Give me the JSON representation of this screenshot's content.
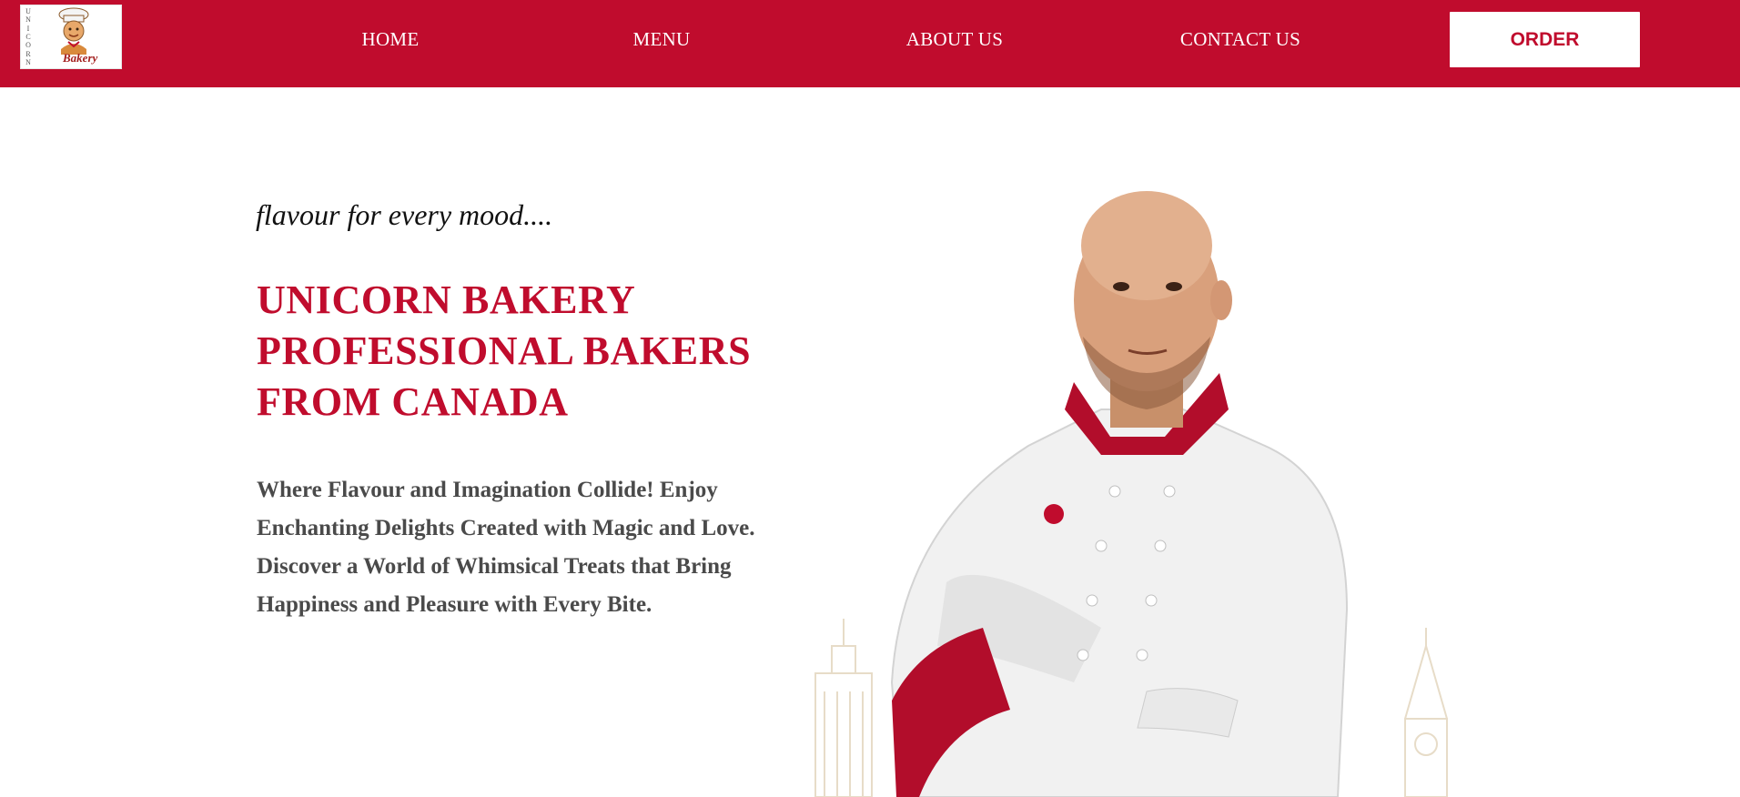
{
  "brand": {
    "logo_vertical_text": "UNICORN",
    "logo_script_text": "Bakery"
  },
  "nav": {
    "items": [
      {
        "label": "HOME"
      },
      {
        "label": "MENU"
      },
      {
        "label": "ABOUT US"
      },
      {
        "label": "CONTACT US"
      }
    ],
    "order_label": "ORDER"
  },
  "hero": {
    "tagline": "flavour for every mood....",
    "headline_lines": [
      "UNICORN BAKERY",
      "PROFESSIONAL BAKERS",
      "FROM CANADA"
    ],
    "description": "Where Flavour and Imagination Collide! Enjoy Enchanting Delights Created with Magic and Love. Discover a World of Whimsical Treats that Bring Happiness and Pleasure with Every Bite."
  },
  "colors": {
    "brand_red": "#c00c2d",
    "text_dark": "#111111",
    "text_gray": "#4a4a4a",
    "white": "#ffffff"
  },
  "icons": {
    "logo": "chef-mascot-logo",
    "hero_image": "chef-portrait-image"
  }
}
